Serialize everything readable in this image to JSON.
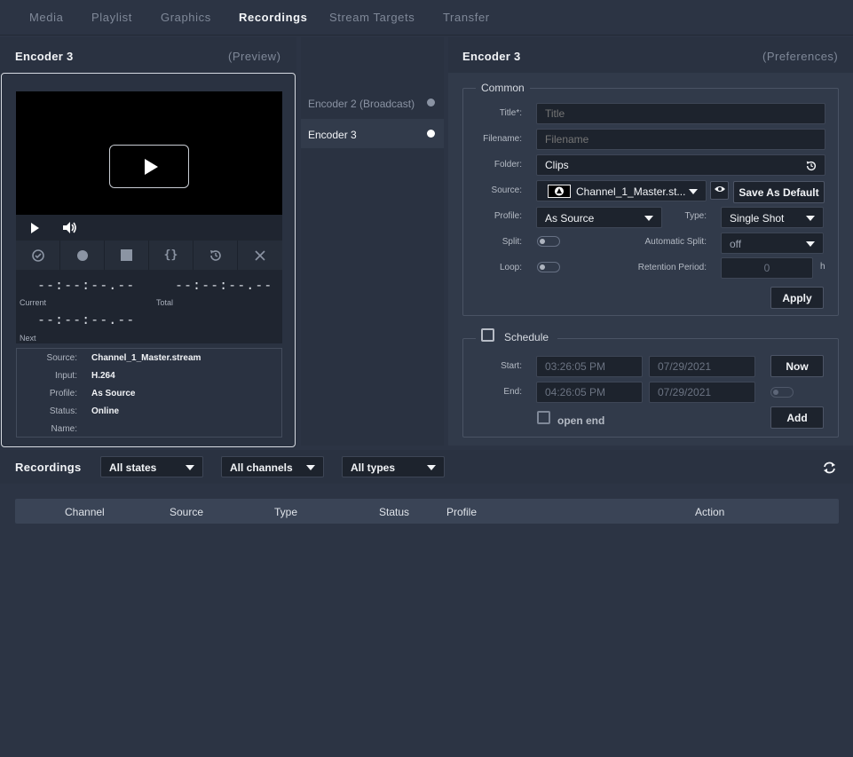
{
  "nav": {
    "tabs": [
      {
        "label": "Media"
      },
      {
        "label": "Playlist"
      },
      {
        "label": "Graphics"
      },
      {
        "label": "Recordings"
      },
      {
        "label": "Stream Targets"
      },
      {
        "label": "Transfer"
      }
    ],
    "active": "Recordings"
  },
  "preview": {
    "title": "Encoder 3",
    "subtitle": "(Preview)",
    "current_time": "--:--:--.--",
    "current_label": "Current",
    "total_time": "--:--:--.--",
    "total_label": "Total",
    "next_time": "--:--:--.--",
    "next_label": "Next",
    "info": [
      {
        "key": "Source:",
        "value": "Channel_1_Master.stream"
      },
      {
        "key": "Input:",
        "value": "H.264"
      },
      {
        "key": "Profile:",
        "value": "As Source"
      },
      {
        "key": "Status:",
        "value": "Online"
      },
      {
        "key": "Name:",
        "value": ""
      }
    ]
  },
  "encoders": [
    {
      "label": "Encoder 2 (Broadcast)",
      "status_color": "#8a93a3"
    },
    {
      "label": "Encoder 3",
      "status_color": "#ffffff"
    }
  ],
  "preferences": {
    "title": "Encoder 3",
    "subtitle": "(Preferences)",
    "common_legend": "Common",
    "title_label": "Title*:",
    "title_placeholder": "Title",
    "filename_label": "Filename:",
    "filename_placeholder": "Filename",
    "folder_label": "Folder:",
    "folder_value": "Clips",
    "source_label": "Source:",
    "source_value": "Channel_1_Master.st...",
    "save_default_label": "Save As Default",
    "profile_label": "Profile:",
    "profile_value": "As Source",
    "type_label": "Type:",
    "type_value": "Single Shot",
    "split_label": "Split:",
    "auto_split_label": "Automatic Split:",
    "auto_split_value": "off",
    "loop_label": "Loop:",
    "retention_label": "Retention Period:",
    "retention_value": "0",
    "retention_unit": "h",
    "apply_label": "Apply",
    "schedule_legend": "Schedule",
    "start_label": "Start:",
    "start_time": "03:26:05 PM",
    "start_date": "07/29/2021",
    "now_label": "Now",
    "end_label": "End:",
    "end_time": "04:26:05 PM",
    "end_date": "07/29/2021",
    "open_end_label": "open end",
    "add_label": "Add"
  },
  "recordings": {
    "title": "Recordings",
    "filters": [
      {
        "value": "All states"
      },
      {
        "value": "All channels"
      },
      {
        "value": "All types"
      }
    ],
    "columns": [
      "Channel",
      "Source",
      "Type",
      "Status",
      "Profile",
      "Action"
    ],
    "rows": []
  }
}
